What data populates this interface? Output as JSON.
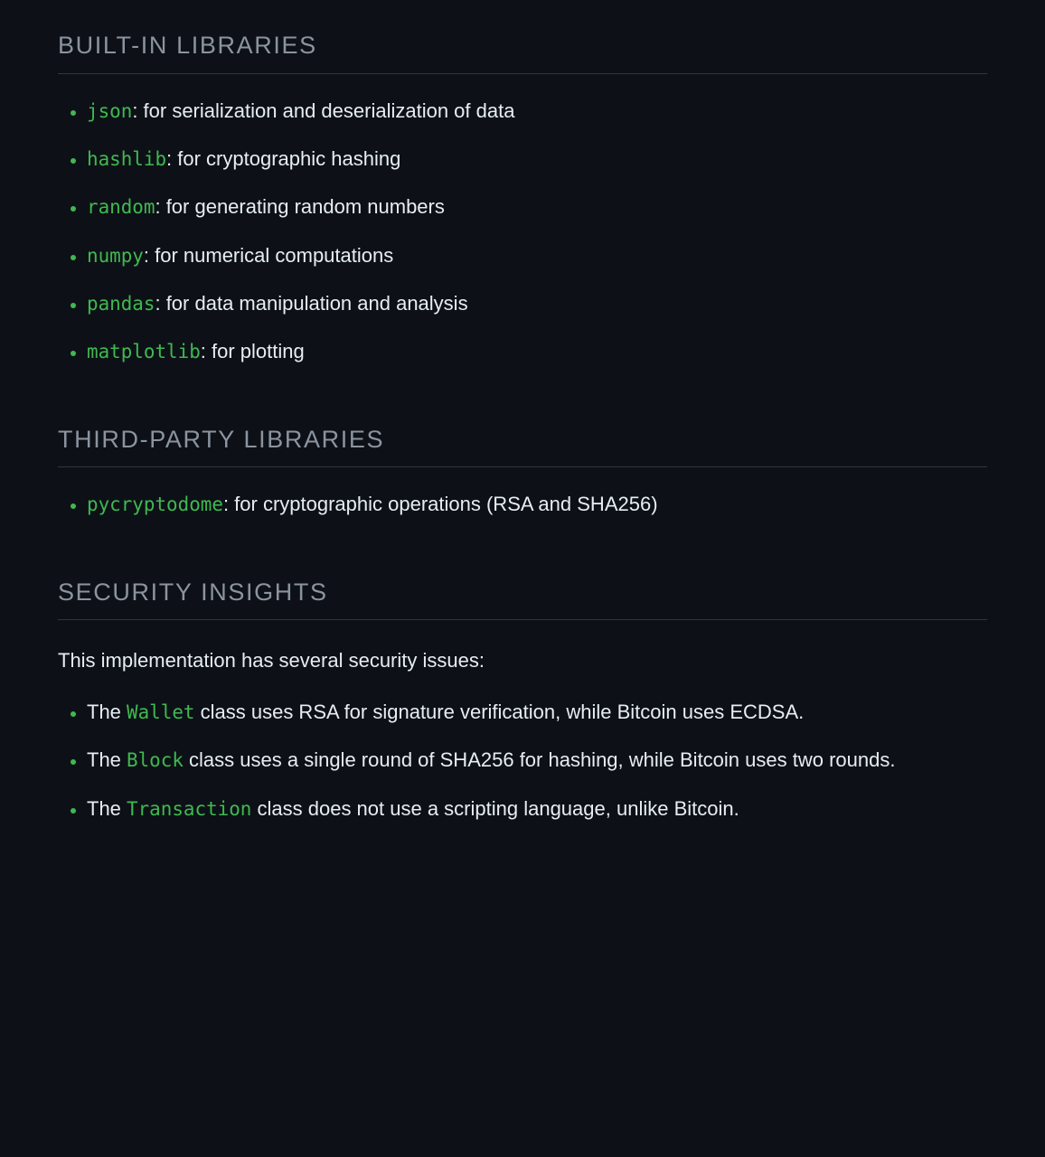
{
  "sections": {
    "builtin": {
      "heading": "BUILT-IN LIBRARIES",
      "items": [
        {
          "code": "json",
          "desc": ": for serialization and deserialization of data"
        },
        {
          "code": "hashlib",
          "desc": ": for cryptographic hashing"
        },
        {
          "code": "random",
          "desc": ": for generating random numbers"
        },
        {
          "code": "numpy",
          "desc": ": for numerical computations"
        },
        {
          "code": "pandas",
          "desc": ": for data manipulation and analysis"
        },
        {
          "code": "matplotlib",
          "desc": ": for plotting"
        }
      ]
    },
    "thirdparty": {
      "heading": "THIRD-PARTY LIBRARIES",
      "items": [
        {
          "code": "pycryptodome",
          "desc": ": for cryptographic operations (RSA and SHA256)"
        }
      ]
    },
    "security": {
      "heading": "SECURITY INSIGHTS",
      "intro": "This implementation has several security issues:",
      "items": [
        {
          "pre": "The ",
          "code": "Wallet",
          "desc": " class uses RSA for signature verification, while Bitcoin uses ECDSA."
        },
        {
          "pre": "The ",
          "code": "Block",
          "desc": " class uses a single round of SHA256 for hashing, while Bitcoin uses two rounds."
        },
        {
          "pre": "The ",
          "code": "Transaction",
          "desc": " class does not use a scripting language, unlike Bitcoin."
        }
      ]
    }
  }
}
